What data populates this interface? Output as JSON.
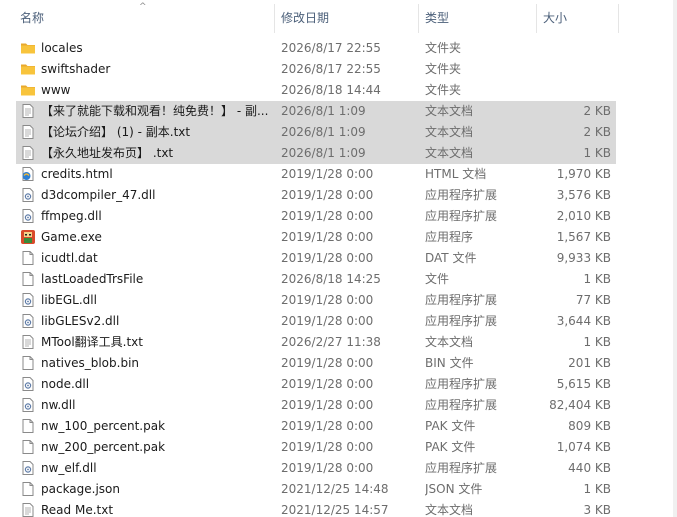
{
  "columns": {
    "name": "名称",
    "date": "修改日期",
    "type": "类型",
    "size": "大小"
  },
  "sort_indicator": "^",
  "files": [
    {
      "name": "locales",
      "date": "2026/8/17 22:55",
      "type": "文件夹",
      "size": "",
      "icon": "folder-icon",
      "selected": false
    },
    {
      "name": "swiftshader",
      "date": "2026/8/17 22:55",
      "type": "文件夹",
      "size": "",
      "icon": "folder-icon",
      "selected": false
    },
    {
      "name": "www",
      "date": "2026/8/18 14:44",
      "type": "文件夹",
      "size": "",
      "icon": "folder-icon",
      "selected": false
    },
    {
      "name": "【来了就能下载和观看！纯免费！】 - 副...",
      "date": "2026/8/1 1:09",
      "type": "文本文档",
      "size": "2 KB",
      "icon": "text-file-icon",
      "selected": true
    },
    {
      "name": "【论坛介绍】 (1) - 副本.txt",
      "date": "2026/8/1 1:09",
      "type": "文本文档",
      "size": "2 KB",
      "icon": "text-file-icon",
      "selected": true
    },
    {
      "name": "【永久地址发布页】 .txt",
      "date": "2026/8/1 1:09",
      "type": "文本文档",
      "size": "1 KB",
      "icon": "text-file-icon",
      "selected": true
    },
    {
      "name": "credits.html",
      "date": "2019/1/28 0:00",
      "type": "HTML 文档",
      "size": "1,970 KB",
      "icon": "html-file-icon",
      "selected": false
    },
    {
      "name": "d3dcompiler_47.dll",
      "date": "2019/1/28 0:00",
      "type": "应用程序扩展",
      "size": "3,576 KB",
      "icon": "dll-file-icon",
      "selected": false
    },
    {
      "name": "ffmpeg.dll",
      "date": "2019/1/28 0:00",
      "type": "应用程序扩展",
      "size": "2,010 KB",
      "icon": "dll-file-icon",
      "selected": false
    },
    {
      "name": "Game.exe",
      "date": "2019/1/28 0:00",
      "type": "应用程序",
      "size": "1,567 KB",
      "icon": "game-exe-icon",
      "selected": false
    },
    {
      "name": "icudtl.dat",
      "date": "2019/1/28 0:00",
      "type": "DAT 文件",
      "size": "9,933 KB",
      "icon": "generic-file-icon",
      "selected": false
    },
    {
      "name": "lastLoadedTrsFile",
      "date": "2026/8/18 14:25",
      "type": "文件",
      "size": "1 KB",
      "icon": "generic-file-icon",
      "selected": false
    },
    {
      "name": "libEGL.dll",
      "date": "2019/1/28 0:00",
      "type": "应用程序扩展",
      "size": "77 KB",
      "icon": "dll-file-icon",
      "selected": false
    },
    {
      "name": "libGLESv2.dll",
      "date": "2019/1/28 0:00",
      "type": "应用程序扩展",
      "size": "3,644 KB",
      "icon": "dll-file-icon",
      "selected": false
    },
    {
      "name": "MTool翻译工具.txt",
      "date": "2026/2/27 11:38",
      "type": "文本文档",
      "size": "1 KB",
      "icon": "text-file-icon",
      "selected": false
    },
    {
      "name": "natives_blob.bin",
      "date": "2019/1/28 0:00",
      "type": "BIN 文件",
      "size": "201 KB",
      "icon": "generic-file-icon",
      "selected": false
    },
    {
      "name": "node.dll",
      "date": "2019/1/28 0:00",
      "type": "应用程序扩展",
      "size": "5,615 KB",
      "icon": "dll-file-icon",
      "selected": false
    },
    {
      "name": "nw.dll",
      "date": "2019/1/28 0:00",
      "type": "应用程序扩展",
      "size": "82,404 KB",
      "icon": "dll-file-icon",
      "selected": false
    },
    {
      "name": "nw_100_percent.pak",
      "date": "2019/1/28 0:00",
      "type": "PAK 文件",
      "size": "809 KB",
      "icon": "generic-file-icon",
      "selected": false
    },
    {
      "name": "nw_200_percent.pak",
      "date": "2019/1/28 0:00",
      "type": "PAK 文件",
      "size": "1,074 KB",
      "icon": "generic-file-icon",
      "selected": false
    },
    {
      "name": "nw_elf.dll",
      "date": "2019/1/28 0:00",
      "type": "应用程序扩展",
      "size": "440 KB",
      "icon": "dll-file-icon",
      "selected": false
    },
    {
      "name": "package.json",
      "date": "2021/12/25 14:48",
      "type": "JSON 文件",
      "size": "1 KB",
      "icon": "generic-file-icon",
      "selected": false
    },
    {
      "name": "Read Me.txt",
      "date": "2021/12/25 14:57",
      "type": "文本文档",
      "size": "3 KB",
      "icon": "text-file-icon",
      "selected": false
    }
  ],
  "colors": {
    "folder": "#f8c43c",
    "selection": "#d9d9d9",
    "header_text": "#4c607a",
    "secondary_text": "#6d6d6d"
  }
}
